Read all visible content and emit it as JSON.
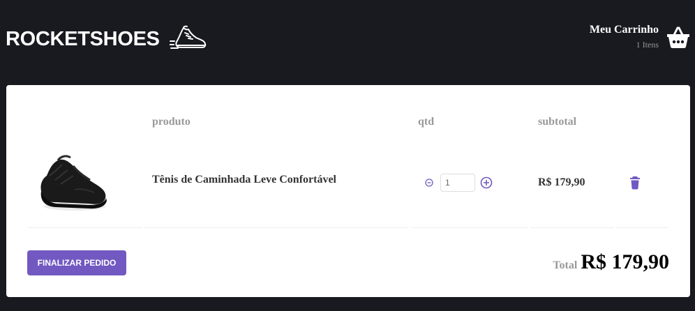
{
  "header": {
    "logo_text": "ROCKETSHOES",
    "cart": {
      "title": "Meu Carrinho",
      "count": "1 Itens"
    }
  },
  "table": {
    "headers": {
      "product": "produto",
      "qty": "qtd",
      "subtotal": "subtotal"
    },
    "rows": [
      {
        "title": "Tênis de Caminhada Leve Confortável",
        "quantity": "1",
        "subtotal": "R$ 179,90"
      }
    ]
  },
  "footer": {
    "checkout_label": "Finalizar pedido",
    "total_label": "Total",
    "total_value": "R$ 179,90"
  },
  "colors": {
    "background": "#191920",
    "accent": "#7159c1",
    "card": "#ffffff"
  },
  "icons": [
    "shoe-logo-icon",
    "basket-icon",
    "remove-circle-icon",
    "add-circle-icon",
    "trash-icon"
  ]
}
